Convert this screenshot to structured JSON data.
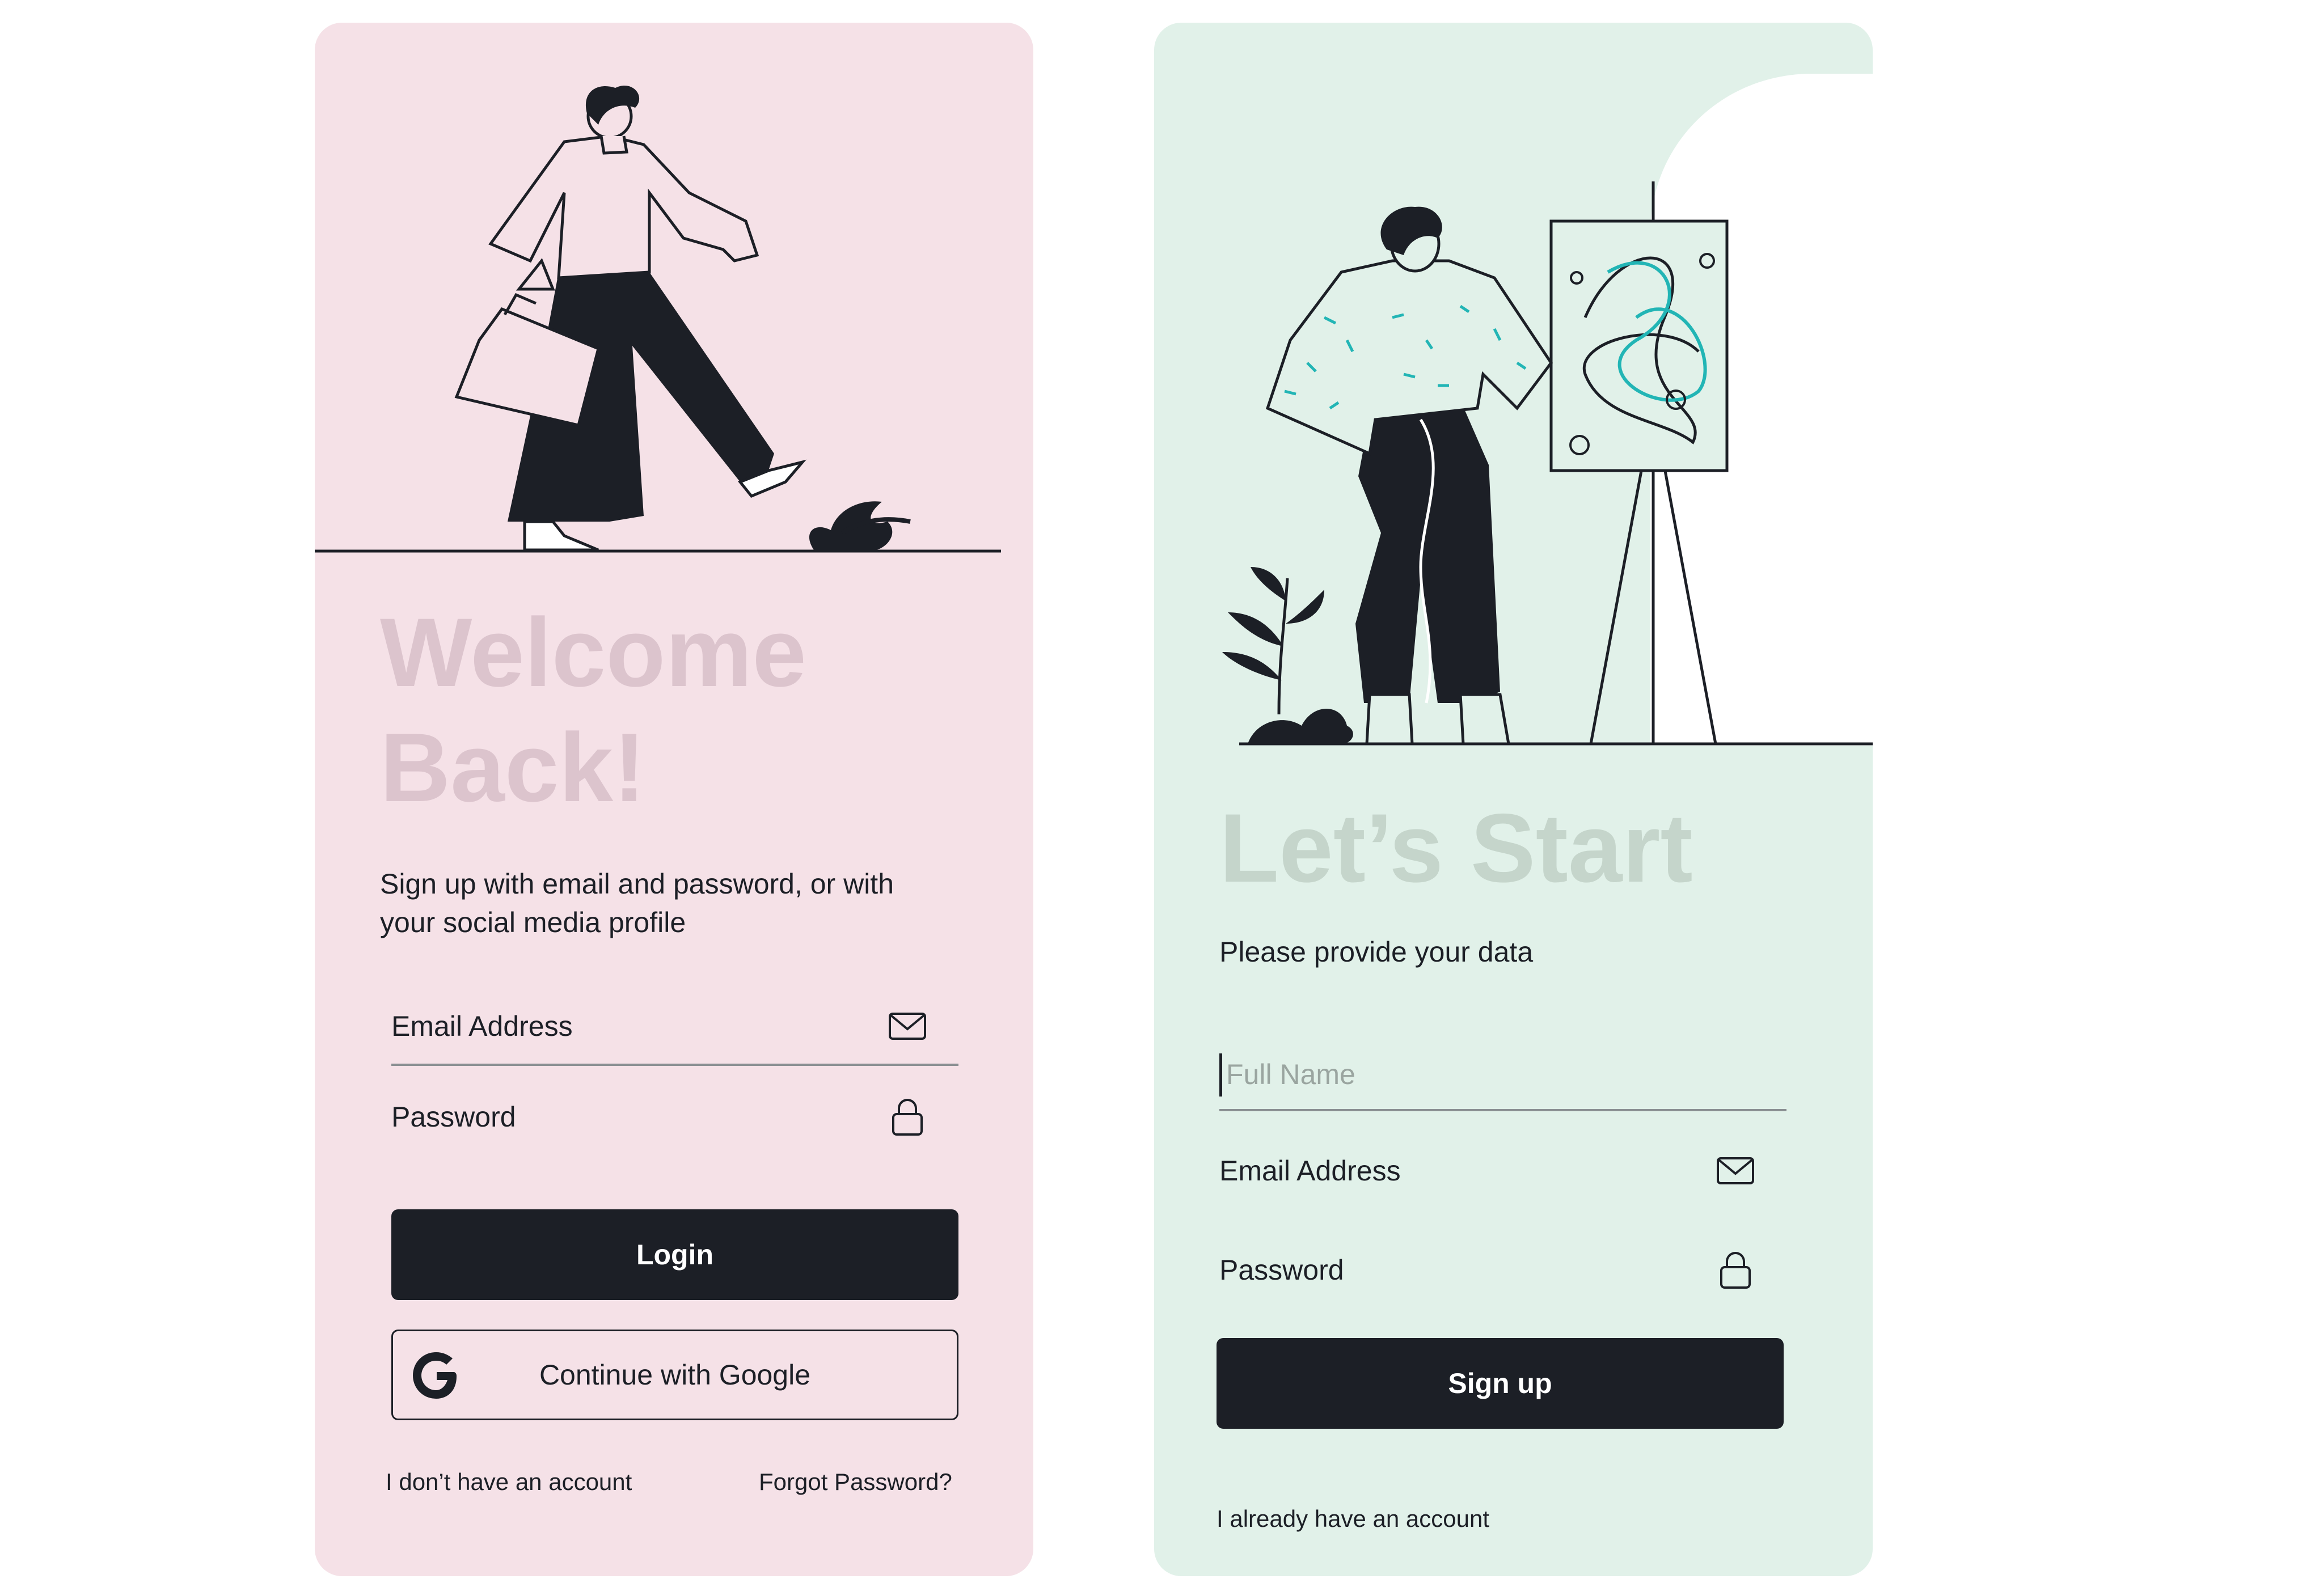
{
  "login": {
    "title_line1": "Welcome",
    "title_line2": "Back!",
    "subtitle_line1": "Sign up with email and password, or with",
    "subtitle_line2": "your social media profile",
    "email_label": "Email Address",
    "password_label": "Password",
    "login_button": "Login",
    "google_button": "Continue with Google",
    "no_account_link": "I don’t have an account",
    "forgot_link": "Forgot Password?",
    "icons": {
      "email": "envelope-icon",
      "password": "lock-icon",
      "google": "google-g-icon"
    }
  },
  "signup": {
    "title": "Let’s Start",
    "subtitle": "Please provide your data",
    "name_placeholder": "Full Name",
    "email_label": "Email Address",
    "password_label": "Password",
    "signup_button": "Sign up",
    "have_account_link": "I already have an account",
    "icons": {
      "email": "envelope-icon",
      "password": "lock-icon"
    }
  },
  "colors": {
    "login_bg": "#f5e1e7",
    "signup_bg": "#e1f1e9",
    "login_title": "#dcc4cd",
    "signup_title": "#c5d5cb",
    "button_dark": "#1c1f26",
    "accent_teal": "#22b5b5"
  }
}
